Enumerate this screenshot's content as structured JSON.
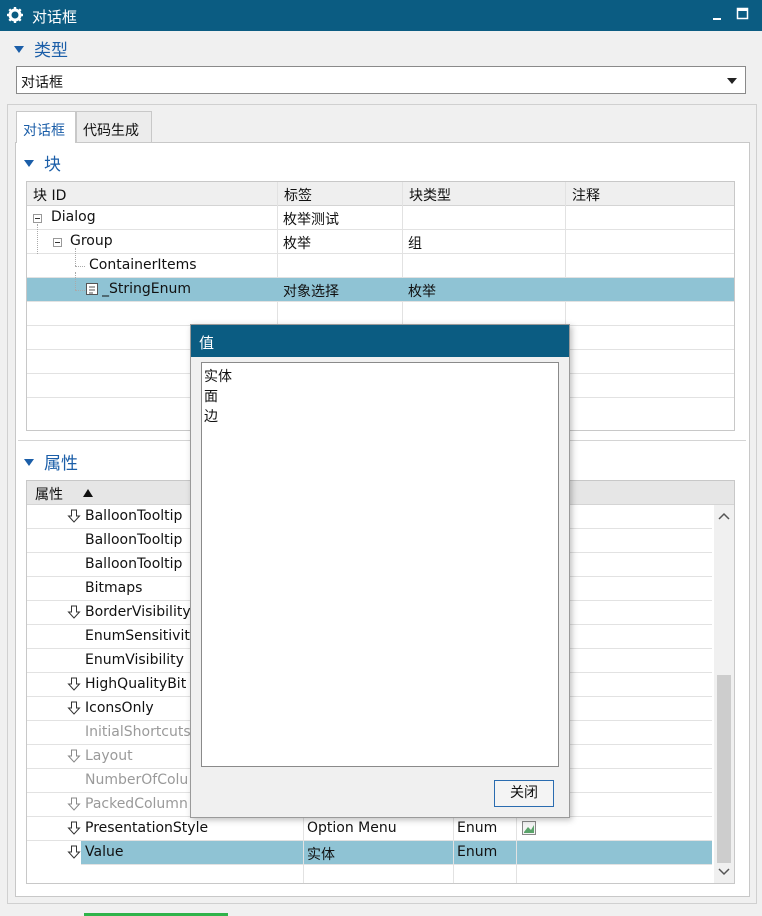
{
  "window": {
    "title": "对话框"
  },
  "type_section": {
    "label": "类型",
    "combo_value": "对话框"
  },
  "tabs": [
    {
      "label": "对话框"
    },
    {
      "label": "代码生成"
    }
  ],
  "block_section": {
    "label": "块",
    "columns": [
      "块 ID",
      "标签",
      "块类型",
      "注释"
    ],
    "rows": [
      {
        "id": "Dialog",
        "label": "枚举测试",
        "type": "",
        "note": ""
      },
      {
        "id": "Group",
        "label": "枚举",
        "type": "组",
        "note": ""
      },
      {
        "id": "ContainerItems",
        "label": "",
        "type": "",
        "note": ""
      },
      {
        "id": "_StringEnum",
        "label": "对象选择",
        "type": "枚举",
        "note": ""
      }
    ]
  },
  "props_section": {
    "label": "属性",
    "column": "属性",
    "rows": [
      {
        "name": "BalloonTooltip",
        "value": "",
        "kind": "",
        "arrow": true,
        "disabled": false
      },
      {
        "name": "BalloonTooltip",
        "value": "",
        "kind": "",
        "arrow": false,
        "disabled": false
      },
      {
        "name": "BalloonTooltip",
        "value": "",
        "kind": "",
        "arrow": false,
        "disabled": false
      },
      {
        "name": "Bitmaps",
        "value": "",
        "kind": "",
        "arrow": false,
        "disabled": false
      },
      {
        "name": "BorderVisibility",
        "value": "",
        "kind": "",
        "arrow": true,
        "disabled": false
      },
      {
        "name": "EnumSensitivit",
        "value": "",
        "kind": "",
        "arrow": false,
        "disabled": false
      },
      {
        "name": "EnumVisibility",
        "value": "",
        "kind": "",
        "arrow": false,
        "disabled": false
      },
      {
        "name": "HighQualityBit",
        "value": "",
        "kind": "",
        "arrow": true,
        "disabled": false
      },
      {
        "name": "IconsOnly",
        "value": "",
        "kind": "",
        "arrow": true,
        "disabled": false
      },
      {
        "name": "InitialShortcuts",
        "value": "",
        "kind": "",
        "arrow": false,
        "disabled": true
      },
      {
        "name": "Layout",
        "value": "",
        "kind": "",
        "arrow": true,
        "disabled": true
      },
      {
        "name": "NumberOfColu",
        "value": "",
        "kind": "",
        "arrow": false,
        "disabled": true
      },
      {
        "name": "PackedColumn",
        "value": "",
        "kind": "",
        "arrow": true,
        "disabled": true
      },
      {
        "name": "PresentationStyle",
        "value": "Option Menu",
        "kind": "Enum",
        "arrow": true,
        "disabled": false
      },
      {
        "name": "Value",
        "value": "实体",
        "kind": "Enum",
        "arrow": true,
        "disabled": false
      }
    ]
  },
  "value_dialog": {
    "title": "值",
    "items": [
      "实体",
      "面",
      "边"
    ],
    "close_label": "关闭"
  },
  "colors": {
    "titlebar": "#0b5c82",
    "selection": "#8fc3d4",
    "section_heading": "#1b5ea8"
  }
}
